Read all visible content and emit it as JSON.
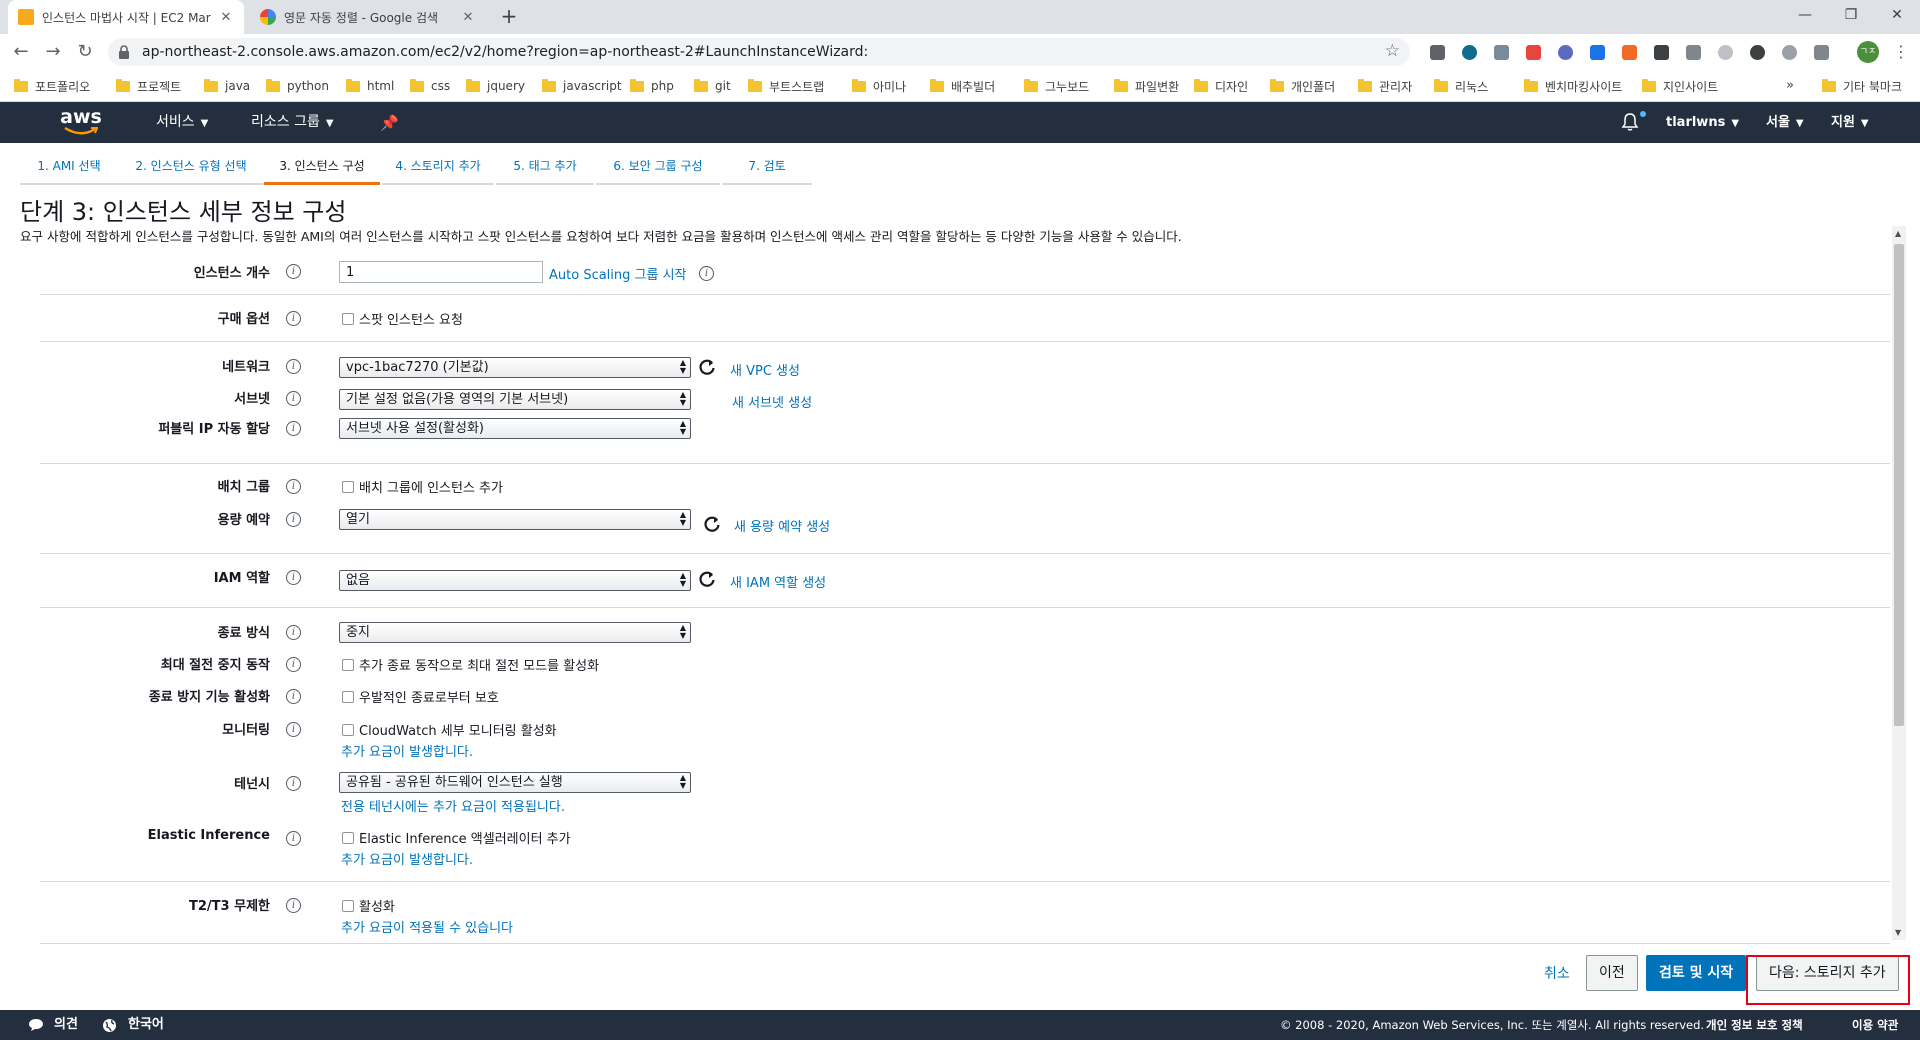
{
  "browser": {
    "tabs": [
      {
        "title": "인스턴스 마법사 시작 | EC2 Mar",
        "active": true
      },
      {
        "title": "영문 자동 정렬 - Google 검색",
        "active": false
      }
    ],
    "new_tab": "+",
    "window_controls": {
      "minimize": "—",
      "maximize": "❐",
      "close": "✕"
    },
    "url": "ap-northeast-2.console.aws.amazon.com/ec2/v2/home?region=ap-northeast-2#LaunchInstanceWizard:",
    "profile_initials": "ㄱㅈ",
    "bookmarks": [
      "포트폴리오",
      "프로젝트",
      "java",
      "python",
      "html",
      "css",
      "jquery",
      "javascript",
      "php",
      "git",
      "부트스트랩",
      "아미나",
      "배추빌더",
      "그누보드",
      "파일변환",
      "디자인",
      "개인폴더",
      "관리자",
      "리눅스",
      "벤치마킹사이트",
      "지인사이트"
    ],
    "bookmarks_more": "»",
    "bookmarks_other": "기타 북마크"
  },
  "aws_nav": {
    "logo": "aws",
    "services": "서비스",
    "resource_groups": "리소스 그룹",
    "user": "tlarlwns",
    "region": "서울",
    "support": "지원"
  },
  "wizard_steps": [
    {
      "label": "1. AMI 선택",
      "active": false
    },
    {
      "label": "2. 인스턴스 유형 선택",
      "active": false
    },
    {
      "label": "3. 인스턴스 구성",
      "active": true
    },
    {
      "label": "4. 스토리지 추가",
      "active": false
    },
    {
      "label": "5. 태그 추가",
      "active": false
    },
    {
      "label": "6. 보안 그룹 구성",
      "active": false
    },
    {
      "label": "7. 검토",
      "active": false
    }
  ],
  "page": {
    "title": "단계 3: 인스턴스 세부 정보 구성",
    "description": "요구 사항에 적합하게 인스턴스를 구성합니다. 동일한 AMI의 여러 인스턴스를 시작하고 스팟 인스턴스를 요청하여 보다 저렴한 요금을 활용하며 인스턴스에 액세스 관리 역할을 할당하는 등 다양한 기능을 사용할 수 있습니다."
  },
  "form": {
    "instance_count": {
      "label": "인스턴스 개수",
      "value": "1",
      "autoscaling_link": "Auto Scaling 그룹 시작"
    },
    "purchase_option": {
      "label": "구매 옵션",
      "checkbox": "스팟 인스턴스 요청"
    },
    "network": {
      "label": "네트워크",
      "value": "vpc-1bac7270 (기본값)",
      "link": "새 VPC 생성"
    },
    "subnet": {
      "label": "서브넷",
      "value": "기본 설정 없음(가용 영역의 기본 서브넷)",
      "link": "새 서브넷 생성"
    },
    "public_ip": {
      "label": "퍼블릭 IP 자동 할당",
      "value": "서브넷 사용 설정(활성화)"
    },
    "placement_group": {
      "label": "배치 그룹",
      "checkbox": "배치 그룹에 인스턴스 추가"
    },
    "capacity_reservation": {
      "label": "용량 예약",
      "value": "열기",
      "link": "새 용량 예약 생성"
    },
    "iam_role": {
      "label": "IAM 역할",
      "value": "없음",
      "link": "새 IAM 역할 생성"
    },
    "shutdown_behavior": {
      "label": "종료 방식",
      "value": "중지"
    },
    "stop_hibernate": {
      "label": "최대 절전 중지 동작",
      "checkbox": "추가 종료 동작으로 최대 절전 모드를 활성화"
    },
    "termination_protection": {
      "label": "종료 방지 기능 활성화",
      "checkbox": "우발적인 종료로부터 보호"
    },
    "monitoring": {
      "label": "모니터링",
      "checkbox": "CloudWatch 세부 모니터링 활성화",
      "note": "추가 요금이 발생합니다."
    },
    "tenancy": {
      "label": "테넌시",
      "value": "공유됨 - 공유된 하드웨어 인스턴스 실행",
      "note": "전용 테넌시에는 추가 요금이 적용됩니다."
    },
    "elastic_inference": {
      "label": "Elastic Inference",
      "checkbox": "Elastic Inference 액셀러레이터 추가",
      "note": "추가 요금이 발생합니다."
    },
    "t2t3_unlimited": {
      "label": "T2/T3 무제한",
      "checkbox": "활성화",
      "note": "추가 요금이 적용될 수 있습니다"
    }
  },
  "info_symbol": "i",
  "actions": {
    "cancel": "취소",
    "previous": "이전",
    "review_launch": "검토 및 시작",
    "next": "다음: 스토리지 추가"
  },
  "footer": {
    "feedback": "의견",
    "language": "한국어",
    "copyright": "© 2008 - 2020, Amazon Web Services, Inc. 또는 계열사. All rights reserved.",
    "privacy": "개인 정보 보호 정책",
    "terms": "이용 약관"
  },
  "colors": {
    "aws_nav_bg": "#232f3e",
    "link": "#0073bb",
    "active_step": "#ec7211",
    "primary_button": "#0073bb",
    "highlight": "#e60012"
  }
}
